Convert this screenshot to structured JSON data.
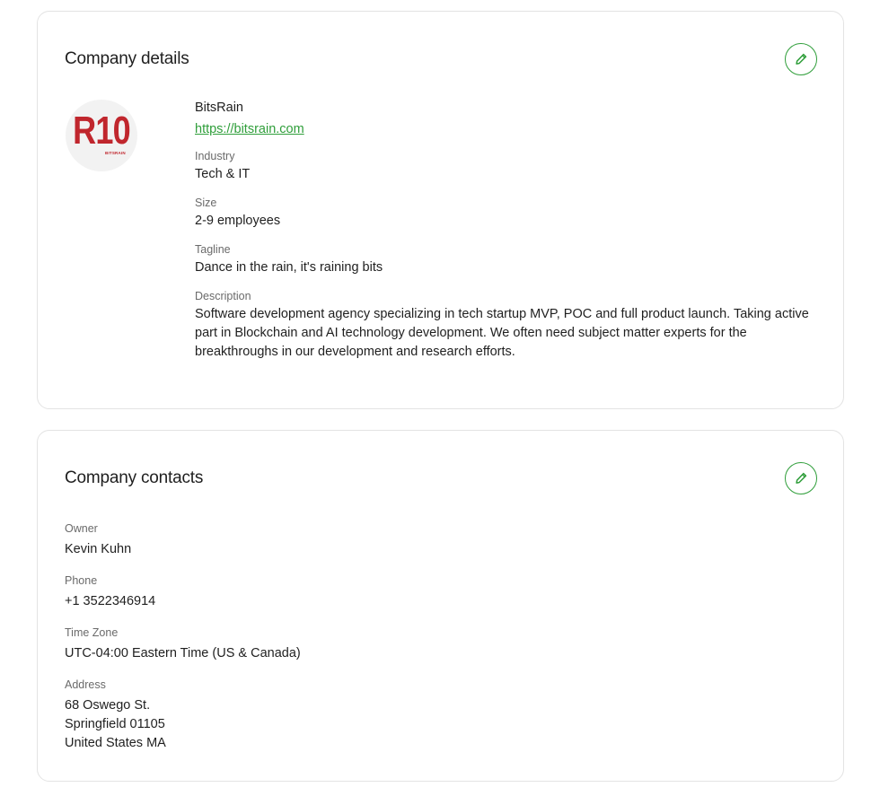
{
  "company_details": {
    "title": "Company details",
    "edit_icon": "pencil-icon",
    "logo": {
      "text": "R10",
      "subtext": "BITSRAIN"
    },
    "name": "BitsRain",
    "url": "https://bitsrain.com",
    "fields": [
      {
        "label": "Industry",
        "value": "Tech & IT"
      },
      {
        "label": "Size",
        "value": "2-9 employees"
      },
      {
        "label": "Tagline",
        "value": "Dance in the rain, it's raining bits"
      },
      {
        "label": "Description",
        "value": "Software development agency specializing in tech startup MVP, POC and full product launch. Taking active part in Blockchain and AI technology development. We often need subject matter experts for the breakthroughs in our development and research efforts."
      }
    ]
  },
  "company_contacts": {
    "title": "Company contacts",
    "edit_icon": "pencil-icon",
    "owner": {
      "label": "Owner",
      "value": "Kevin Kuhn"
    },
    "phone": {
      "label": "Phone",
      "value": "+1 3522346914"
    },
    "timezone": {
      "label": "Time Zone",
      "value": "UTC-04:00 Eastern Time (US & Canada)"
    },
    "address": {
      "label": "Address",
      "lines": [
        "68 Oswego St.",
        "Springfield 01105",
        "United States MA"
      ]
    }
  },
  "colors": {
    "accent": "#2f9e3a",
    "logo_red": "#c0262d",
    "border": "#e3e3e3"
  }
}
